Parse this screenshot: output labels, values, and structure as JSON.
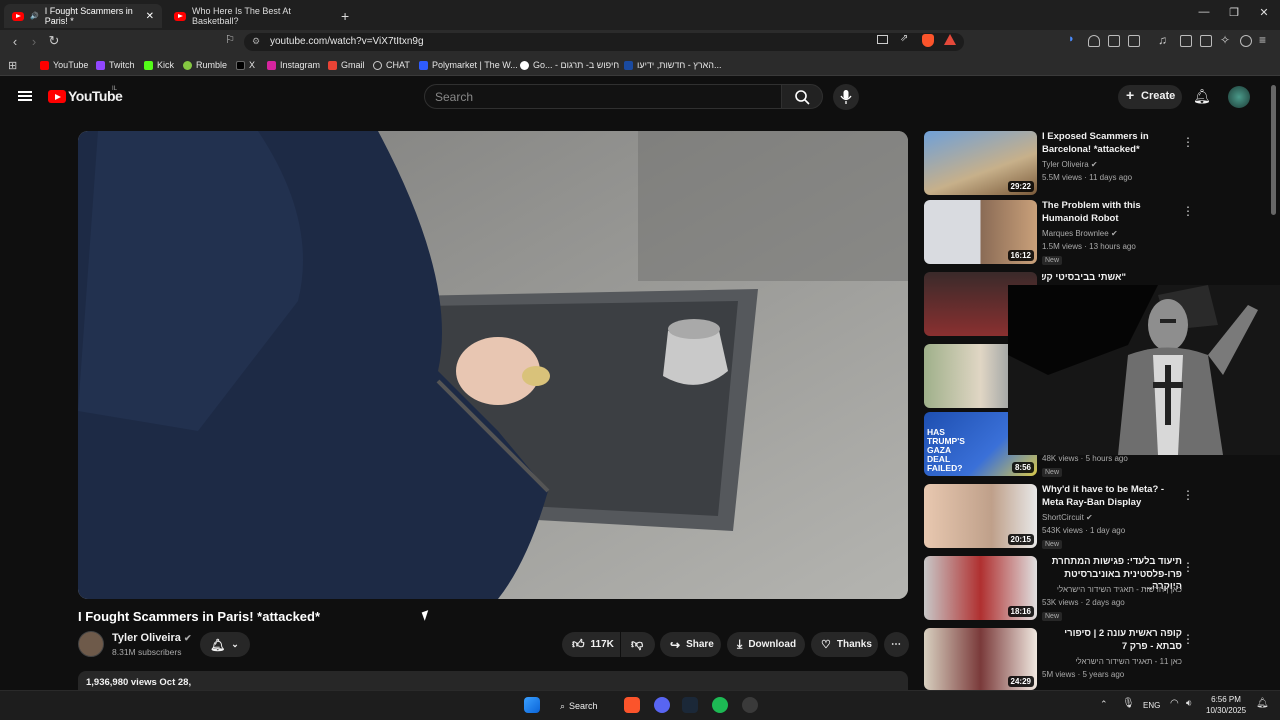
{
  "browser": {
    "tabs": [
      {
        "title": "I Fought Scammers in Paris! *"
      },
      {
        "title": "Who Here Is The Best At Basketball?"
      }
    ],
    "url": "youtube.com/watch?v=ViX7tItxn9g",
    "bookmarks": [
      "YouTube",
      "Twitch",
      "Kick",
      "Rumble",
      "X",
      "Instagram",
      "Gmail",
      "CHAT",
      "Polymarket | The W...",
      "Go... - חיפוש ב- תרגום",
      "הארץ - חדשות, ידיעו..."
    ]
  },
  "youtube": {
    "logo_text": "YouTube",
    "region": "IL",
    "search_placeholder": "Search",
    "create_label": "Create"
  },
  "video": {
    "title": "I Fought Scammers in Paris! *attacked*",
    "channel": "Tyler Oliveira",
    "subscribers": "8.31M subscribers",
    "likes": "117K",
    "share_label": "Share",
    "download_label": "Download",
    "thanks_label": "Thanks",
    "views_date": "1,936,980 views  Oct 28,"
  },
  "recommendations": [
    {
      "title": "I Exposed Scammers in Barcelona! *attacked*",
      "channel": "Tyler Oliveira",
      "meta": "5.5M views · 11 days ago",
      "duration": "29:22",
      "badge": ""
    },
    {
      "title": "The Problem with this Humanoid Robot",
      "channel": "Marques Brownlee",
      "meta": "1.5M views · 13 hours ago",
      "duration": "16:12",
      "badge": "New"
    },
    {
      "title": "\"אשתי בביבסיטי קשוחה\": מאיך עבד...",
      "channel": "",
      "meta": "",
      "duration": "",
      "badge": ""
    },
    {
      "title": "",
      "channel": "",
      "meta": "",
      "duration": "",
      "badge": ""
    },
    {
      "title": "",
      "channel": "",
      "meta": "48K views · 5 hours ago",
      "duration": "8:56",
      "badge": "New"
    },
    {
      "title": "Why'd it have to be Meta? - Meta Ray-Ban Display",
      "channel": "ShortCircuit",
      "meta": "543K views · 1 day ago",
      "duration": "20:15",
      "badge": "New"
    },
    {
      "title": "תיעוד בלעדי: פגישות המתחרת פרו-פלסטינית באוניברסיטת היוקרה...",
      "channel": "כאן | חדשות - תאגיד השידור הישראלי",
      "meta": "53K views · 2 days ago",
      "duration": "18:16",
      "badge": "New"
    },
    {
      "title": "קופה ראשית עונה 2 | סיפורי סבתא - פרק 7",
      "channel": "כאן 11 - תאגיד השידור הישראלי",
      "meta": "5M views · 5 years ago",
      "duration": "24:29",
      "badge": ""
    }
  ],
  "thumb_text": {
    "gaza": "HAS TRUMP'S GAZA DEAL FAILED?"
  },
  "taskbar": {
    "search_label": "Search",
    "lang": "ENG",
    "time": "6:56 PM",
    "date": "10/30/2025"
  },
  "colors": {
    "youtube_red": "#ff0000",
    "background": "#0f0f0f",
    "chip": "#272727"
  }
}
